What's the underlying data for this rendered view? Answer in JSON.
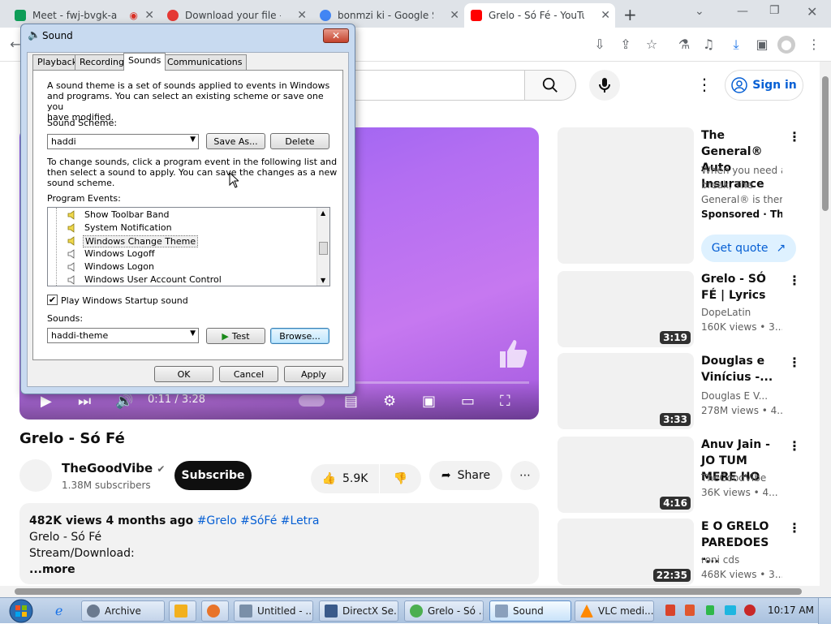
{
  "browser": {
    "tabs": [
      {
        "label": "Meet - fwj-bvgk-a",
        "icon_color": "#0f9d58",
        "active": false
      },
      {
        "label": "Download your file —",
        "icon_color": "#e53935",
        "active": false
      },
      {
        "label": "bonmzi ki - Google Se",
        "icon_color": "#4285f4",
        "active": false
      },
      {
        "label": "Grelo - Só Fé - YouTu",
        "icon_color": "#ff0000",
        "active": true
      }
    ],
    "new_tab": "+",
    "window_controls": {
      "minimize": "⌄",
      "restore": "❐",
      "close": "✕"
    }
  },
  "youtube": {
    "sign_in": "Sign in",
    "video_title": "Grelo - Só Fé",
    "player": {
      "time": "0:11 / 3:28"
    },
    "channel": {
      "name": "TheGoodVibe",
      "subscribers": "1.38M subscribers",
      "subscribe": "Subscribe"
    },
    "actions": {
      "likes": "5.9K",
      "share": "Share",
      "more": "⋯"
    },
    "description": {
      "stats": "482K views  4 months ago",
      "tags": "#Grelo #SóFé #Letra",
      "line1": "Grelo - Só Fé",
      "line2": "Stream/Download:",
      "more": "...more"
    },
    "recommendations": [
      {
        "title": "The General® Auto Insurance",
        "line1": "When you need a",
        "line2": "break, The",
        "line3": "General® is ther...",
        "line4": "Sponsored · The...",
        "cta": "Get quote"
      },
      {
        "title": "Grelo - SÓ FÉ | Lyrics",
        "channel": "DopeLatin",
        "meta": "160K views  • 3...",
        "duration": "3:19"
      },
      {
        "title": "Douglas e Vinícius -...",
        "channel": "Douglas E V...",
        "meta": "278M views  • 4...",
        "duration": "3:33"
      },
      {
        "title": "Anuv Jain - JO TUM MERE HO",
        "channel": "TheGoodVibe",
        "meta": "36K views  • 4...",
        "duration": "4:16"
      },
      {
        "title": "E O GRELO PAREDOES -...",
        "channel": "roni cds",
        "meta": "468K views  • 3...",
        "duration": "22:35"
      }
    ]
  },
  "dialog": {
    "title": "Sound",
    "tabs": [
      "Playback",
      "Recording",
      "Sounds",
      "Communications"
    ],
    "selected_tab": "Sounds",
    "intro": [
      "A sound theme is a set of sounds applied to events in Windows",
      "and programs.  You can select an existing scheme or save one you",
      "have modified."
    ],
    "scheme_label": "Sound Scheme:",
    "scheme_value": "haddi",
    "save_as": "Save As...",
    "delete": "Delete",
    "instructions": [
      "To change sounds, click a program event in the following list and",
      "then select a sound to apply.  You can save the changes as a new",
      "sound scheme."
    ],
    "events_label": "Program Events:",
    "events": [
      {
        "label": "Show Toolbar Band",
        "has_sound": true
      },
      {
        "label": "System Notification",
        "has_sound": true
      },
      {
        "label": "Windows Change Theme",
        "has_sound": true,
        "selected": true
      },
      {
        "label": "Windows Logoff",
        "has_sound": false
      },
      {
        "label": "Windows Logon",
        "has_sound": false
      },
      {
        "label": "Windows User Account Control",
        "has_sound": false
      }
    ],
    "startup_sound_label": "Play Windows Startup sound",
    "startup_sound_checked": true,
    "sounds_label": "Sounds:",
    "sound_value": "haddi-theme",
    "test": "Test",
    "browse": "Browse...",
    "ok": "OK",
    "cancel": "Cancel",
    "apply": "Apply"
  },
  "taskbar": {
    "items": [
      {
        "label": "Archive",
        "active": false
      },
      {
        "label": "Untitled - ...",
        "active": false
      },
      {
        "label": "DirectX Se...",
        "active": false
      },
      {
        "label": "Grelo - Só ...",
        "active": false
      },
      {
        "label": "Sound",
        "active": true
      },
      {
        "label": "VLC medi...",
        "active": false
      }
    ],
    "clock": "10:17 AM"
  }
}
